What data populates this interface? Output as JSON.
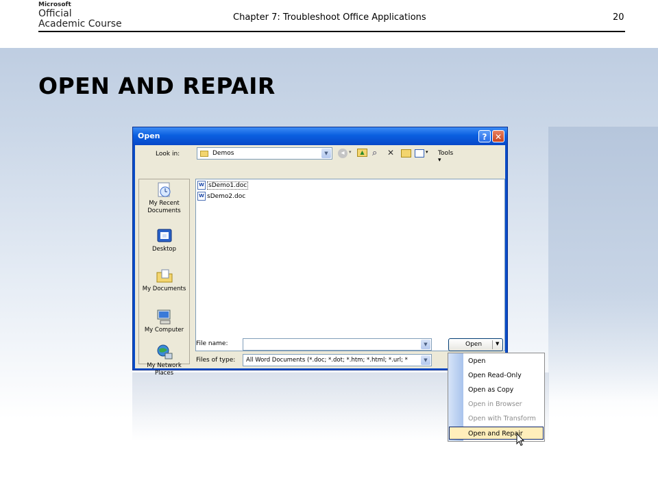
{
  "header": {
    "logo_brand": "Microsoft",
    "logo_line1": "Official",
    "logo_line2": "Academic Course",
    "chapter_title": "Chapter 7: Troubleshoot Office Applications",
    "page_number": "20"
  },
  "slide_title": "OPEN AND REPAIR",
  "dialog": {
    "title": "Open",
    "help_button": "?",
    "close_button": "✕",
    "look_in_label": "Look in:",
    "look_in_value": "Demos",
    "tools_label": "Tools",
    "places": [
      {
        "label": "My Recent Documents",
        "icon": "recent-documents-icon"
      },
      {
        "label": "Desktop",
        "icon": "desktop-icon"
      },
      {
        "label": "My Documents",
        "icon": "my-documents-icon"
      },
      {
        "label": "My Computer",
        "icon": "my-computer-icon"
      },
      {
        "label": "My Network Places",
        "icon": "network-places-icon"
      }
    ],
    "files": [
      "sDemo1.doc",
      "sDemo2.doc"
    ],
    "file_name_label": "File name:",
    "file_name_value": "",
    "files_of_type_label": "Files of type:",
    "files_of_type_value": "All Word Documents (*.doc; *.dot; *.htm; *.html; *.url; *",
    "open_button": "Open"
  },
  "open_menu": [
    {
      "label": "Open",
      "enabled": true
    },
    {
      "label": "Open Read-Only",
      "enabled": true
    },
    {
      "label": "Open as Copy",
      "enabled": true
    },
    {
      "label": "Open in Browser",
      "enabled": false
    },
    {
      "label": "Open with Transform",
      "enabled": false
    },
    {
      "label": "Open and Repair",
      "enabled": true,
      "highlighted": true
    }
  ]
}
